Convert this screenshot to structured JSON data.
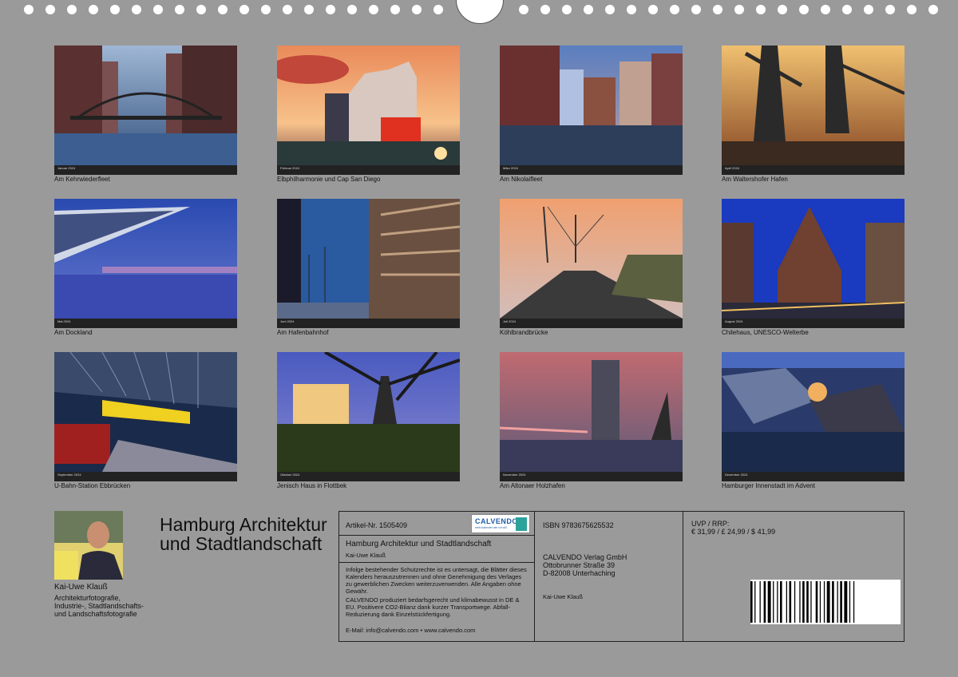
{
  "months": [
    {
      "caption": "Am Kehrwiederfleet",
      "month_label": "Januar 2024"
    },
    {
      "caption": "Elbphilharmonie und Cap San Diego",
      "month_label": "Februar 2024"
    },
    {
      "caption": "Am Nikolaifleet",
      "month_label": "März 2024"
    },
    {
      "caption": "Am Waltershofer Hafen",
      "month_label": "April 2024"
    },
    {
      "caption": "Am Dockland",
      "month_label": "Mai 2024"
    },
    {
      "caption": "Am Hafenbahnhof",
      "month_label": "Juni 2024"
    },
    {
      "caption": "Köhlbrandbrücke",
      "month_label": "Juli 2024"
    },
    {
      "caption": "Chilehaus, UNESCO-Welterbe",
      "month_label": "August 2024"
    },
    {
      "caption": "U-Bahn-Station Ebbrücken",
      "month_label": "September 2024"
    },
    {
      "caption": "Jenisch Haus in Flottbek",
      "month_label": "Oktober 2024"
    },
    {
      "caption": "Am Altonaer Holzhafen",
      "month_label": "November 2024"
    },
    {
      "caption": "Hamburger Innenstadt im Advent",
      "month_label": "Dezember 2024"
    }
  ],
  "author": {
    "name": "Kai-Uwe Klauß",
    "description": "Architekturfotografie, Industrie-, Stadtlandschafts- und Landschaftsfotografie"
  },
  "title": "Hamburg Architektur und Stadtlandschaft",
  "info": {
    "article_no": "Artikel-Nr. 1505409",
    "logo_text": "CALVENDO",
    "logo_sub": "mein kalender wie ich will",
    "calendar_title": "Hamburg Architektur und Stadtlandschaft",
    "calendar_author": "Kai-Uwe Klauß",
    "legal_1": "Infolge bestehender Schutzrechte ist es untersagt, die Blätter dieses Kalenders herauszutrennen und ohne Genehmigung des Verlages zu gewerblichen Zwecken weiterzuverwenden. Alle Angaben ohne Gewähr.",
    "legal_2": "CALVENDO produziert bedarfsgerecht und klimabewusst in DE & EU. Positivere CO2-Bilanz dank kurzer Transportwege. Abfall-Reduzierung dank Einzelstückfertigung.",
    "contact": "E-Mail: info@calvendo.com • www.calvendo.com",
    "isbn": "ISBN 9783675625532",
    "publisher_name": "CALVENDO Verlag GmbH",
    "publisher_street": "Ottobrunner Straße 39",
    "publisher_city": "D-82008 Unterhaching",
    "publisher_author": "Kai-Uwe Klauß",
    "price_label": "UVP / RRP:",
    "price_values": "€ 31,99 / £ 24,99 / $ 41,99"
  },
  "colors": {
    "background": "#9a9a9a",
    "logo_blue": "#1f5ea8",
    "logo_teal": "#2ba39a"
  }
}
